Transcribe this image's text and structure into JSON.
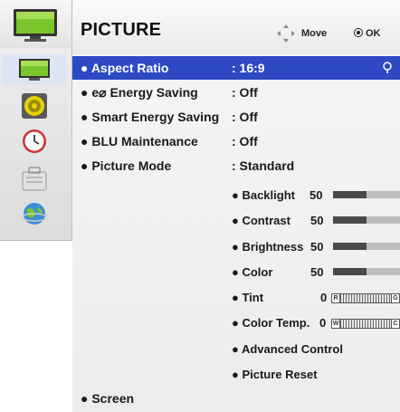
{
  "header": {
    "title": "PICTURE",
    "move_label": "Move",
    "ok_label": "OK"
  },
  "sidebar": {
    "items": [
      {
        "icon": "tv-icon",
        "active": false
      },
      {
        "icon": "picture-icon",
        "active": true
      },
      {
        "icon": "speaker-icon",
        "active": false
      },
      {
        "icon": "clock-icon",
        "active": false
      },
      {
        "icon": "lock-icon",
        "active": false
      },
      {
        "icon": "globe-icon",
        "active": false
      }
    ]
  },
  "menu": {
    "items": [
      {
        "label": "● Aspect Ratio",
        "value": ": 16:9",
        "selected": true
      },
      {
        "label": "● e⌀ Energy Saving",
        "value": ": Off"
      },
      {
        "label": "● Smart Energy Saving",
        "value": ": Off"
      },
      {
        "label": "● BLU Maintenance",
        "value": ": Off"
      },
      {
        "label": "● Picture Mode",
        "value": ": Standard"
      }
    ],
    "screen_label": "● Screen"
  },
  "picture_settings": [
    {
      "label": "● Backlight",
      "value": "50",
      "level": 0.5
    },
    {
      "label": "● Contrast",
      "value": "50",
      "level": 0.5
    },
    {
      "label": "● Brightness",
      "value": "50",
      "level": 0.5
    },
    {
      "label": "● Color",
      "value": "50",
      "level": 0.5
    },
    {
      "label": "● Tint",
      "value": "0",
      "left_mark": "R",
      "right_mark": "G"
    },
    {
      "label": "● Color Temp.",
      "value": "0",
      "left_mark": "W",
      "right_mark": "C"
    },
    {
      "label": "● Advanced Control"
    },
    {
      "label": "● Picture Reset"
    }
  ],
  "colors": {
    "selection": "#2e49c4",
    "bar_fill": "#4a4a4a",
    "bar_track": "#bdbdbd"
  }
}
